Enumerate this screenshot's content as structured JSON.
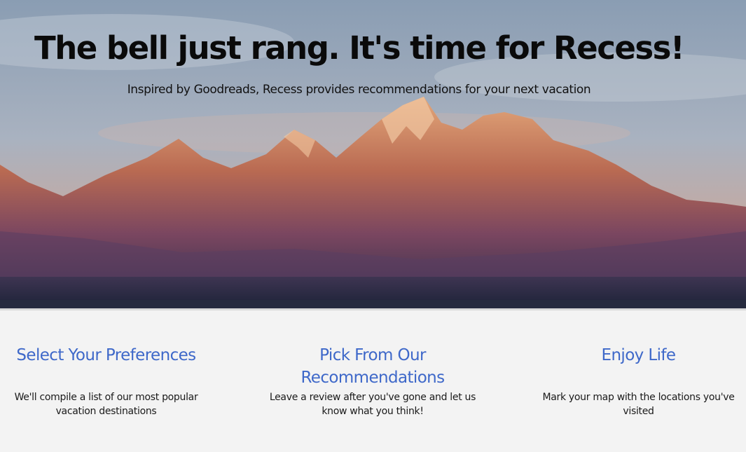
{
  "hero": {
    "title": "The bell just rang. It's time for Recess!",
    "subtitle": "Inspired by Goodreads, Recess provides recommendations for your next vacation"
  },
  "features": [
    {
      "heading": "Select Your Preferences",
      "text": "We'll compile a list of our most popular vacation destinations"
    },
    {
      "heading": "Pick From Our Recommendations",
      "text": "Leave a review after you've gone and let us know what you think!"
    },
    {
      "heading": "Enjoy Life",
      "text": "Mark your map with the locations you've visited"
    }
  ],
  "colors": {
    "accent": "#3e68c9",
    "background": "#f3f3f3"
  }
}
